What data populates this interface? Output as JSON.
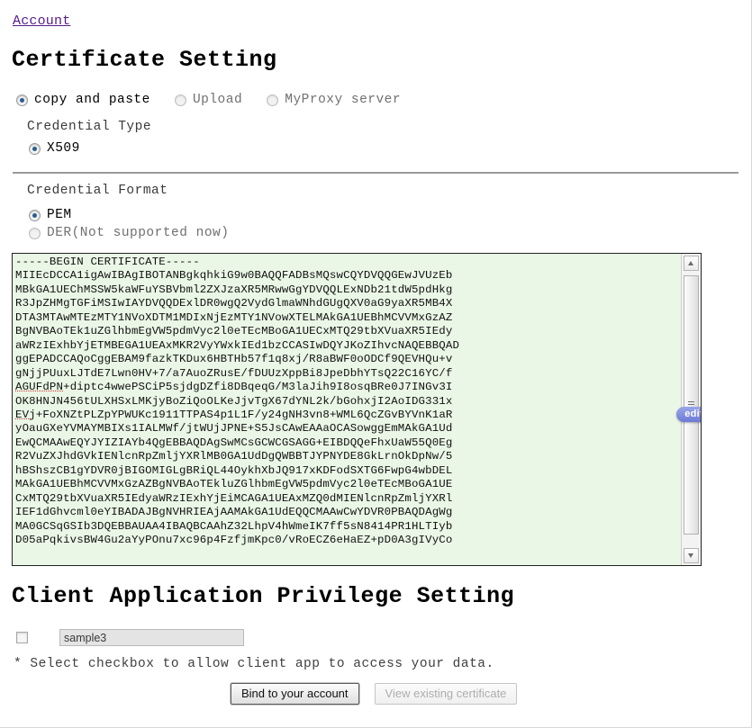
{
  "breadcrumb": {
    "account_link": "Account"
  },
  "cert_section": {
    "title": "Certificate Setting",
    "source_options": [
      {
        "label": "copy and paste",
        "selected": true
      },
      {
        "label": "Upload",
        "selected": false
      },
      {
        "label": "MyProxy server",
        "selected": false
      }
    ],
    "credential_type_label": "Credential Type",
    "credential_type_options": [
      {
        "label": "X509",
        "selected": true
      }
    ],
    "credential_format_label": "Credential Format",
    "credential_format_options": [
      {
        "label": "PEM",
        "selected": true
      },
      {
        "label": "DER(Not supported now)",
        "selected": false
      }
    ],
    "edit_badge": "edit",
    "certificate_lines": [
      "-----BEGIN CERTIFICATE-----",
      "MIIEcDCCA1igAwIBAgIBOTANBgkqhkiG9w0BAQQFADBsMQswCQYDVQQGEwJVUzEb",
      "MBkGA1UEChMSSW5kaWFuYSBVbml2ZXJzaXR5MRwwGgYDVQQLExNDb21tdW5pdHkg",
      "R3JpZHMgTGFiMSIwIAYDVQQDExlDR0wgQ2VydGlmaWNhdGUgQXV0aG9yaXR5MB4X",
      "DTA3MTAwMTEzMTY1NVoXDTM1MDIxNjEzMTY1NVowXTELMAkGA1UEBhMCVVMxGzAZ",
      "BgNVBAoTEk1uZGlhbmEgVW5pdmVyc2l0eTEcMBoGA1UECxMTQ29tbXVuaXR5IEdy",
      "aWRzIExhbYjETMBEGA1UEAxMKR2VyYWxkIEd1bzCCASIwDQYJKoZIhvcNAQEBBQAD",
      "ggEPADCCAQoCggEBAM9fazkTKDux6HBTHb57f1q8xj/R8aBWF0oODCf9QEVHQu+v",
      "gNjjPUuxLJTdE7Lwn0HV+7/a7AuoZRusE/fDUUzXppBi8JpeDbhYTsQ22C16YC/f",
      "AGUFdPN+diptc4wwePSCiP5sjdgDZfi8DBqeqG/M3laJih9I8osqBRe0J7INGv3I",
      "OK8HNJN456tULXHSxLMKjyBoZiQoOLKeJjvTgX67dYNL2k/bGohxjI2AoIDG331x",
      "EVj+FoXNZtPLZpYPWUKc1911TTPAS4p1L1F/y24gNH3vn8+WML6QcZGvBYVnK1aR",
      "yOauGXeYVMAYMBIXs1IALMWf/jtWUjJPNE+S5JsCAwEAAaOCASowggEmMAkGA1Ud",
      "EwQCMAAwEQYJYIZIAYb4QgEBBAQDAgSwMCsGCWCGSAGG+EIBDQQeFhxUaW55Q0Eg",
      "R2VuZXJhdGVkIENlcnRpZmljYXRlMB0GA1UdDgQWBBTJYPNYDE8GkLrnOkDpNw/5",
      "hBShszCB1gYDVR0jBIGOMIGLgBRiQL44OykhXbJQ917xKDFodSXTG6FwpG4wbDEL",
      "MAkGA1UEBhMCVVMxGzAZBgNVBAoTEkluZGlhbmEgVW5pdmVyc2l0eTEcMBoGA1UE",
      "CxMTQ29tbXVuaXR5IEdyaWRzIExhYjEiMCAGA1UEAxMZQ0dMIENlcnRpZmljYXRl",
      "IEF1dGhvcml0eYIBADAJBgNVHRIEAjAAMAkGA1UdEQQCMAAwCwYDVR0PBAQDAgWg",
      "MA0GCSqGSIb3DQEBBAUAA4IBAQBCAAhZ32LhpV4hWmeIK7ff5sN8414PR1HLTIyb",
      "D05aPqkivsBW4Gu2aYyPOnu7xc96p4FzfjmKpc0/vRoECZ6eHaEZ+pD0A3gIVyCo"
    ],
    "spellcheck_tokens": [
      "AGUFdPN",
      "EVj",
      "jtWUjJPNE"
    ]
  },
  "privilege_section": {
    "title": "Client Application Privilege Setting",
    "app_checkbox_checked": false,
    "app_name_value": "sample3",
    "hint": "* Select checkbox to allow client app to access your data."
  },
  "buttons": {
    "bind": "Bind to your account",
    "view": "View existing certificate"
  }
}
